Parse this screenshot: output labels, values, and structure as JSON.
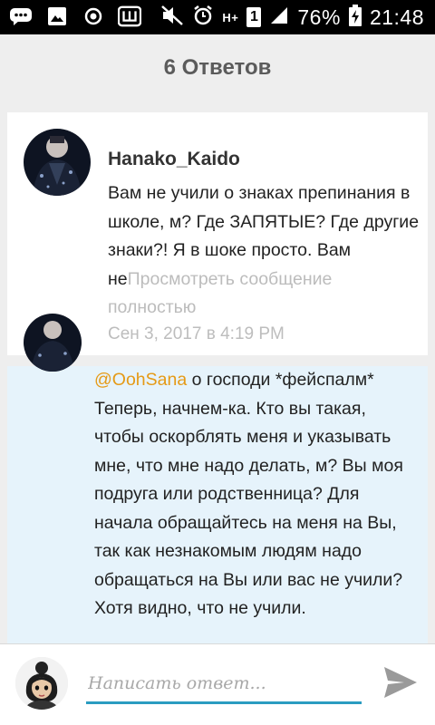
{
  "status_bar": {
    "battery": "76%",
    "time": "21:48",
    "sim": "1",
    "network": "H+"
  },
  "header": {
    "title": "6 Ответов"
  },
  "comment": {
    "username": "Hanako_Kaido",
    "text": "Вам не учили о знаках препинания в школе, м? Где ЗАПЯТЫЕ? Где другие знаки?! Я в шоке просто. Вам не",
    "more_link": "Просмотреть сообщение полностью",
    "timestamp": "Сен 3, 2017 в 4:19 PM"
  },
  "reply": {
    "mention": "@OohSana",
    "text": " о господи *фейспалм* Теперь, начнем-ка. Кто вы такая, чтобы оскорблять меня и указывать мне, что мне надо делать, м? Вы моя подруга или родственница? Для начала обращайтесь на меня на Вы, так как незнакомым людям надо обращаться на Вы или вас не учили? Хотя видно, что не учили."
  },
  "composer": {
    "placeholder": "Написать ответ..."
  },
  "colors": {
    "accent": "#2a9cc0",
    "mention": "#e59a16",
    "reply_background": "#e6f3fb",
    "muted_text": "#bdbdbd"
  },
  "icons": [
    "chat-icon",
    "image-icon",
    "record-icon",
    "keyboard-icon",
    "mute-icon",
    "alarm-icon",
    "network-icon",
    "sim-icon",
    "signal-icon",
    "battery-icon",
    "send-icon"
  ]
}
